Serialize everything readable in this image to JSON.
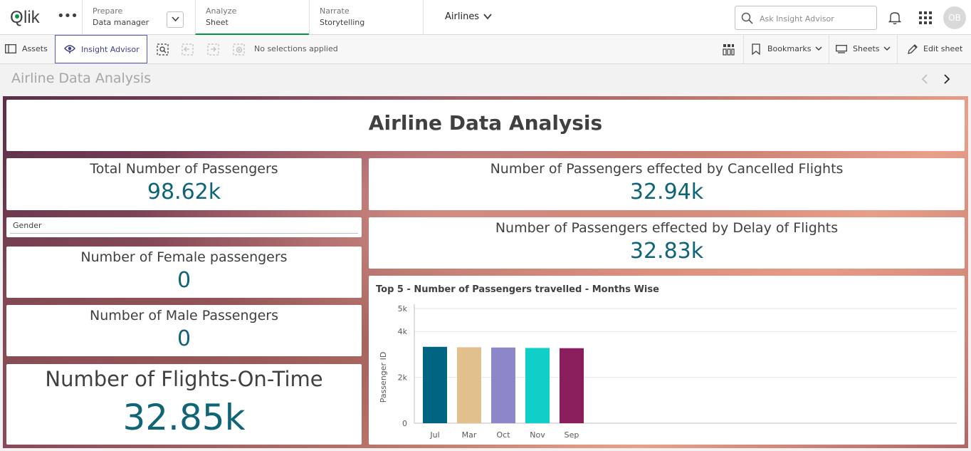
{
  "nav": {
    "logo": "Qlik",
    "prepare": {
      "label": "Prepare",
      "value": "Data manager"
    },
    "analyze": {
      "label": "Analyze",
      "value": "Sheet"
    },
    "narrate": {
      "label": "Narrate",
      "value": "Storytelling"
    },
    "app_name": "Airlines",
    "search_placeholder": "Ask Insight Advisor",
    "avatar": "OB"
  },
  "toolbar": {
    "assets": "Assets",
    "insight_advisor": "Insight Advisor",
    "no_selections": "No selections applied",
    "bookmarks": "Bookmarks",
    "sheets": "Sheets",
    "edit_sheet": "Edit sheet"
  },
  "sheet": {
    "title": "Airline Data Analysis"
  },
  "dashboard": {
    "header_title": "Airline Data Analysis",
    "total_passengers": {
      "label": "Total Number of Passengers",
      "value": "98.62k"
    },
    "cancelled": {
      "label": "Number of Passengers effected by Cancelled Flights",
      "value": "32.94k"
    },
    "gender": {
      "label": "Gender"
    },
    "delay": {
      "label": "Number of Passengers effected by Delay of Flights",
      "value": "32.83k"
    },
    "female": {
      "label": "Number of Female passengers",
      "value": "0"
    },
    "male": {
      "label": "Number of Male Passengers",
      "value": "0"
    },
    "on_time": {
      "label": "Number of Flights-On-Time",
      "value": "32.85k"
    }
  },
  "colors": {
    "kpi_value": "#0f6577",
    "active_tab": "#009845",
    "insight_border": "#595cae"
  },
  "chart_data": {
    "type": "bar",
    "title": "Top 5 - Number of Passengers travelled - Months Wise",
    "categories": [
      "Jul",
      "Mar",
      "Oct",
      "Nov",
      "Sep"
    ],
    "values": [
      3330,
      3310,
      3300,
      3280,
      3270
    ],
    "colors": [
      "#006580",
      "#e1c08e",
      "#8b87c8",
      "#10cfc9",
      "#8a1e5c"
    ],
    "ylabel": "Passenger ID",
    "xlabel": "",
    "ylim": [
      0,
      5000
    ],
    "yticks": [
      0,
      2000,
      4000,
      5000
    ],
    "ytick_labels": [
      "0",
      "2k",
      "4k",
      "5k"
    ],
    "grid": true
  }
}
